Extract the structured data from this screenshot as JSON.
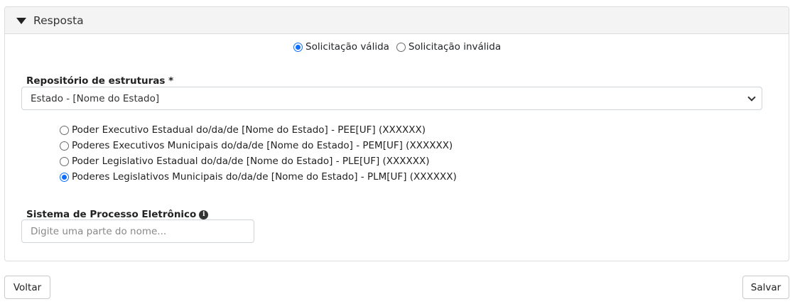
{
  "panel": {
    "title": "Resposta"
  },
  "validity": {
    "options": [
      {
        "label": "Solicitação válida",
        "checked": true
      },
      {
        "label": "Solicitação inválida",
        "checked": false
      }
    ]
  },
  "repository": {
    "label": "Repositório de estruturas *",
    "selected": "Estado - [Nome do Estado]",
    "options": [
      {
        "label": "Poder Executivo Estadual do/da/de [Nome do Estado] - PEE[UF] (XXXXXX)",
        "checked": false
      },
      {
        "label": "Poderes Executivos Municipais do/da/de [Nome do Estado] - PEM[UF] (XXXXXX)",
        "checked": false
      },
      {
        "label": "Poder Legislativo Estadual do/da/de [Nome do Estado] - PLE[UF] (XXXXXX)",
        "checked": false
      },
      {
        "label": "Poderes Legislativos Municipais do/da/de [Nome do Estado] - PLM[UF] (XXXXXX)",
        "checked": true
      }
    ]
  },
  "system": {
    "label": "Sistema de Processo Eletrônico",
    "info_icon": "info-circle-icon",
    "placeholder": "Digite uma parte do nome..."
  },
  "actions": {
    "back_label": "Voltar",
    "save_label": "Salvar"
  },
  "colors": {
    "accent": "#0d6efd",
    "header_bg": "#f4f4f4",
    "border": "#dcdcdc"
  }
}
